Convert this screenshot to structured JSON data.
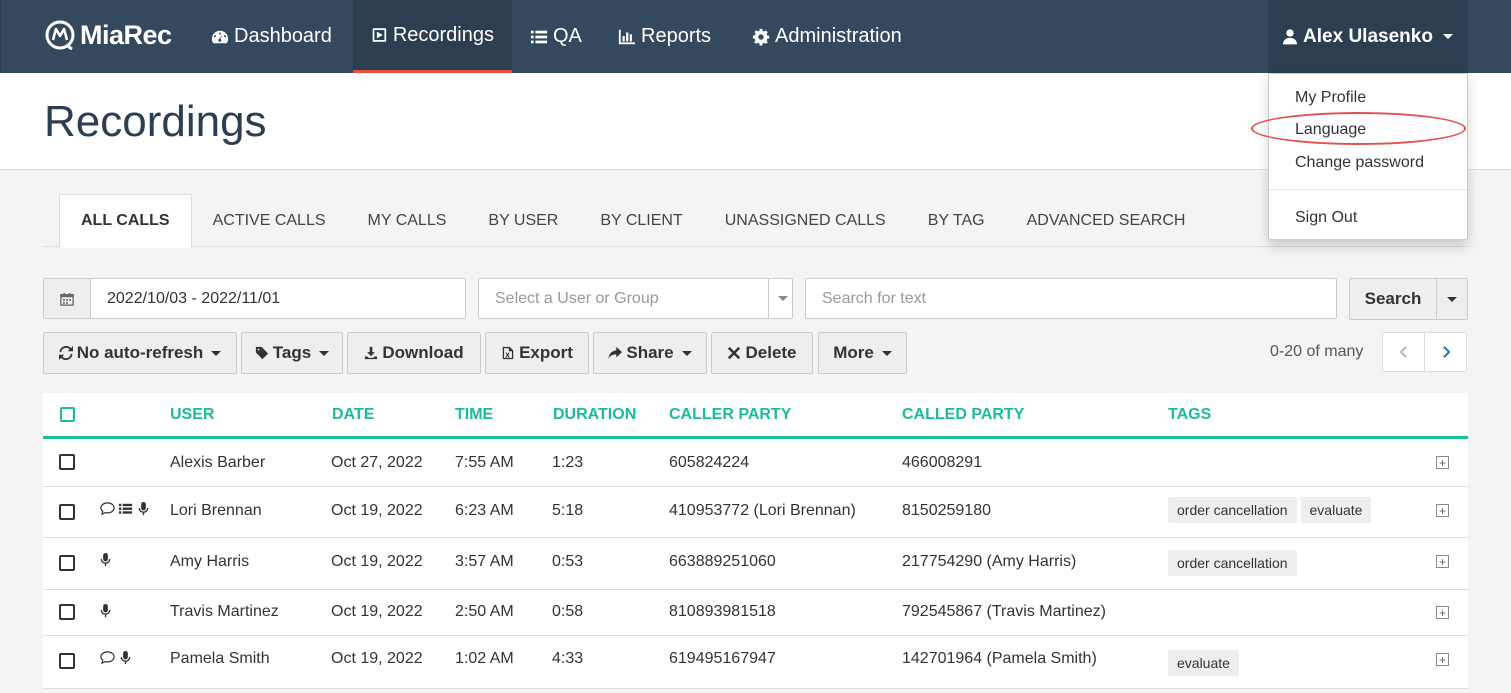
{
  "navbar": {
    "brand": "MiaRec",
    "items": [
      {
        "label": "Dashboard",
        "icon": "dashboard-icon"
      },
      {
        "label": "Recordings",
        "icon": "play-icon",
        "active": true
      },
      {
        "label": "QA",
        "icon": "list-icon"
      },
      {
        "label": "Reports",
        "icon": "bar-chart-icon"
      },
      {
        "label": "Administration",
        "icon": "gear-icon"
      }
    ],
    "user": "Alex Ulasenko"
  },
  "page_title": "Recordings",
  "tabs": [
    "ALL CALLS",
    "ACTIVE CALLS",
    "MY CALLS",
    "BY USER",
    "BY CLIENT",
    "UNASSIGNED CALLS",
    "BY TAG",
    "ADVANCED SEARCH"
  ],
  "filters": {
    "date_range": "2022/10/03 - 2022/11/01",
    "user_placeholder": "Select a User or Group",
    "search_placeholder": "Search for text",
    "search_button": "Search"
  },
  "toolbar": {
    "refresh": "No auto-refresh",
    "tags": "Tags",
    "download": "Download",
    "export": "Export",
    "share": "Share",
    "delete": "Delete",
    "more": "More"
  },
  "pager": {
    "text": "0-20 of many"
  },
  "table": {
    "headers": {
      "user": "USER",
      "date": "DATE",
      "time": "TIME",
      "duration": "DURATION",
      "caller": "CALLER PARTY",
      "called": "CALLED PARTY",
      "tags": "TAGS"
    },
    "rows": [
      {
        "user": "Alexis Barber",
        "date": "Oct 27, 2022",
        "time": "7:55 AM",
        "duration": "1:23",
        "caller": "605824224",
        "called": "466008291",
        "icons": [],
        "tags": []
      },
      {
        "user": "Lori Brennan",
        "date": "Oct 19, 2022",
        "time": "6:23 AM",
        "duration": "5:18",
        "caller": "410953772 (Lori Brennan)",
        "called": "8150259180",
        "icons": [
          "comment-icon",
          "list-icon",
          "microphone-icon"
        ],
        "tags": [
          "order cancellation",
          "evaluate"
        ]
      },
      {
        "user": "Amy Harris",
        "date": "Oct 19, 2022",
        "time": "3:57 AM",
        "duration": "0:53",
        "caller": "663889251060",
        "called": "217754290 (Amy Harris)",
        "icons": [
          "microphone-icon"
        ],
        "tags": [
          "order cancellation"
        ]
      },
      {
        "user": "Travis Martinez",
        "date": "Oct 19, 2022",
        "time": "2:50 AM",
        "duration": "0:58",
        "caller": "810893981518",
        "called": "792545867 (Travis Martinez)",
        "icons": [
          "microphone-icon"
        ],
        "tags": []
      },
      {
        "user": "Pamela Smith",
        "date": "Oct 19, 2022",
        "time": "1:02 AM",
        "duration": "4:33",
        "caller": "619495167947",
        "called": "142701964 (Pamela Smith)",
        "icons": [
          "comment-icon",
          "microphone-icon"
        ],
        "tags": [
          "evaluate"
        ]
      }
    ]
  },
  "user_menu": {
    "items": [
      "My Profile",
      "Language",
      "Change password",
      "Sign Out"
    ],
    "highlighted": "Language"
  },
  "colors": {
    "navbar": "#34495e",
    "accent": "#1abc9c",
    "active_underline": "#e74c3c",
    "highlight": "#e05252"
  }
}
